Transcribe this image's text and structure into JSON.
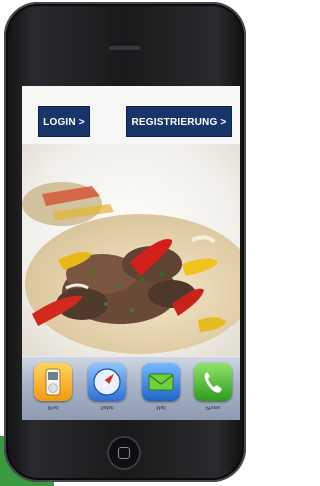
{
  "screen": {
    "login_label": "LOGIN >",
    "register_label": "REGISTRIERUNG >"
  },
  "dock": {
    "apps": [
      {
        "label": "iPod"
      },
      {
        "label": "Safari"
      },
      {
        "label": "Mail"
      },
      {
        "label": "Phone"
      }
    ]
  },
  "colors": {
    "button_bg": "#17356b",
    "accent_green": "#3a9a3f"
  }
}
